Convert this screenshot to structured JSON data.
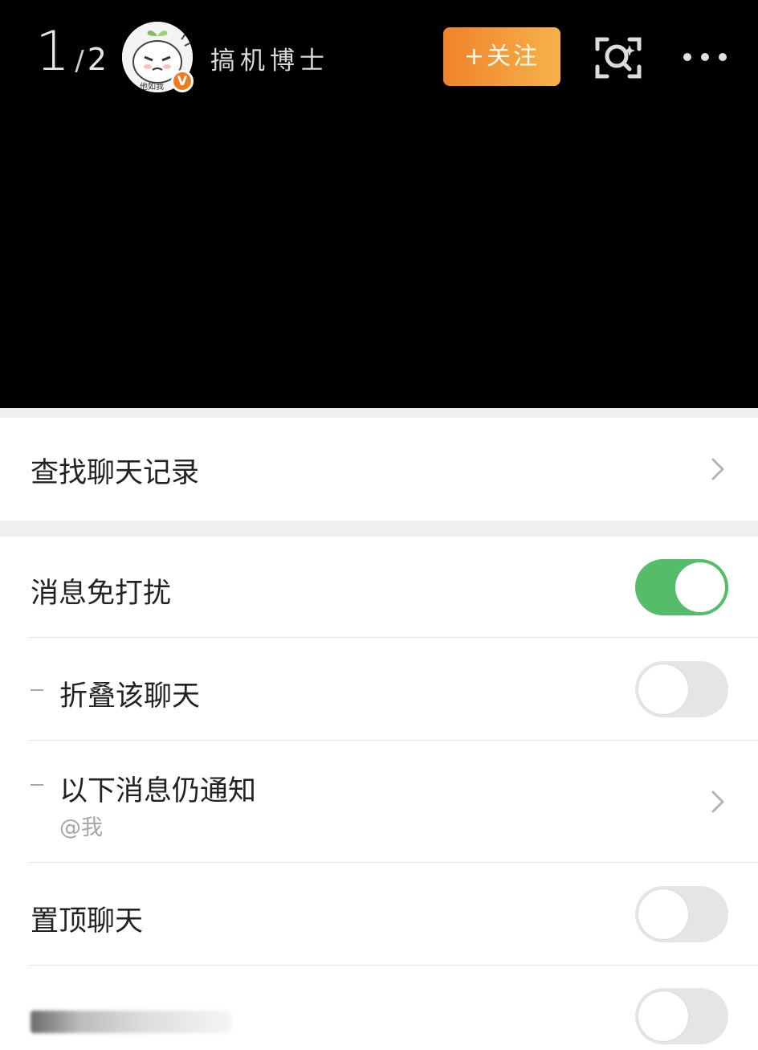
{
  "header": {
    "counter_current": "1",
    "counter_sep": "/",
    "counter_total": "2",
    "avatar_caption": "他如我",
    "verified_badge": "V",
    "username": "搞机博士",
    "follow_label": "+关注",
    "scan_icon": "scan-search-icon",
    "more_icon": "more-dots-icon"
  },
  "rows": {
    "search_history": {
      "label": "查找聊天记录"
    },
    "mute": {
      "label": "消息免打扰",
      "on": true
    },
    "fold": {
      "label": "折叠该聊天",
      "on": false
    },
    "still_notify": {
      "label": "以下消息仍通知",
      "sublabel": "@我"
    },
    "pin": {
      "label": "置顶聊天",
      "on": false
    },
    "hidden_row": {
      "on": false
    }
  },
  "colors": {
    "toggle_on": "#55bd6a",
    "toggle_off": "#e5e5e5",
    "follow_start": "#f0822c",
    "follow_end": "#f6b24a",
    "badge": "#f07b1c"
  }
}
